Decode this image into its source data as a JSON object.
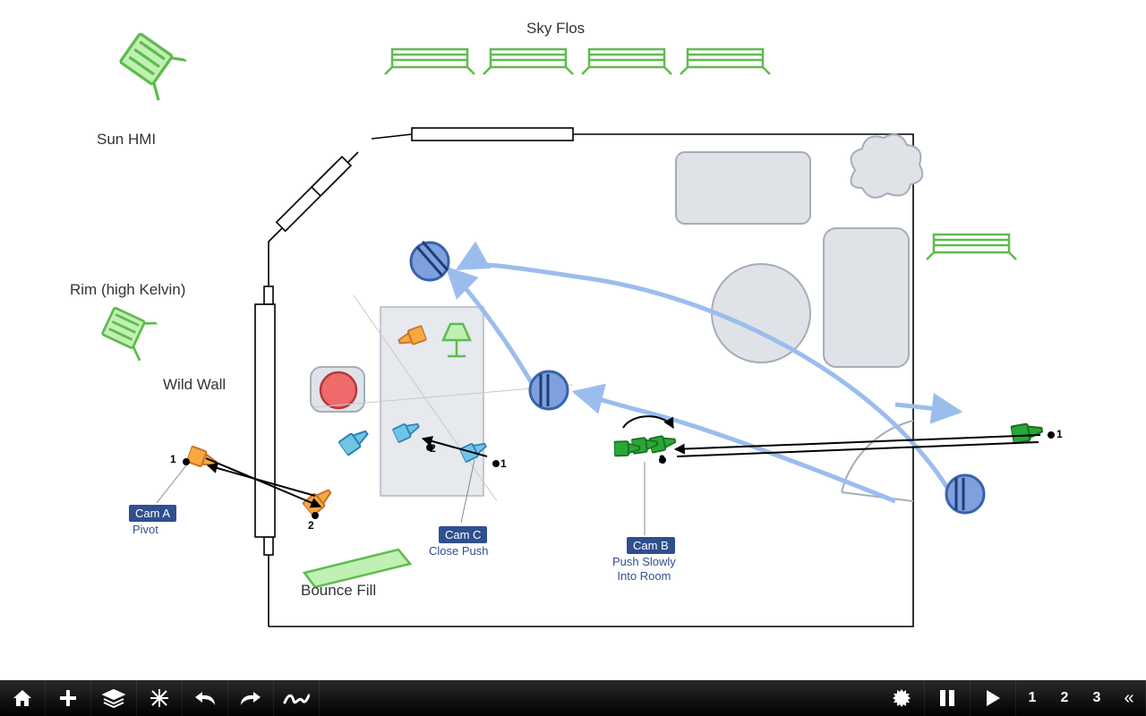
{
  "labels": {
    "sky_flos": "Sky Flos",
    "sun_hmi": "Sun HMI",
    "rim": "Rim (high Kelvin)",
    "wild_wall": "Wild Wall",
    "bounce_fill": "Bounce Fill"
  },
  "cameras": {
    "a": {
      "chip": "Cam A",
      "sub": "Pivot"
    },
    "b": {
      "chip": "Cam B",
      "sub": "Push Slowly\nInto Room"
    },
    "c": {
      "chip": "Cam C",
      "sub": "Close Push"
    }
  },
  "numbers": {
    "one": "1",
    "two": "2",
    "three": "3"
  },
  "colors": {
    "wall": "#000",
    "actor_stroke": "#3a63ad",
    "actor_fill": "#7ea0dc",
    "motion": "#9bbdee",
    "cam_blue_fill": "#6fc5e6",
    "cam_blue_stroke": "#2e7fb5",
    "cam_orange_fill": "#f7a83e",
    "cam_orange_stroke": "#c4732c",
    "cam_green_fill": "#2aa736",
    "cam_green_stroke": "#1a6f24",
    "light_fill": "#c0f0b4",
    "light_stroke": "#5fbb4e",
    "furniture_fill": "#dfe3e8",
    "furniture_stroke": "#a5adb7",
    "red_fill": "#ef6a6a",
    "red_stroke": "#b23a3a"
  },
  "toolbar": {
    "left_icons": [
      "home",
      "plus",
      "layers",
      "snowflake",
      "undo",
      "redo",
      "squiggle"
    ],
    "right_icons": [
      "gear",
      "pause",
      "play"
    ],
    "right_numbers": [
      "1",
      "2",
      "3"
    ],
    "collapse": "«"
  }
}
